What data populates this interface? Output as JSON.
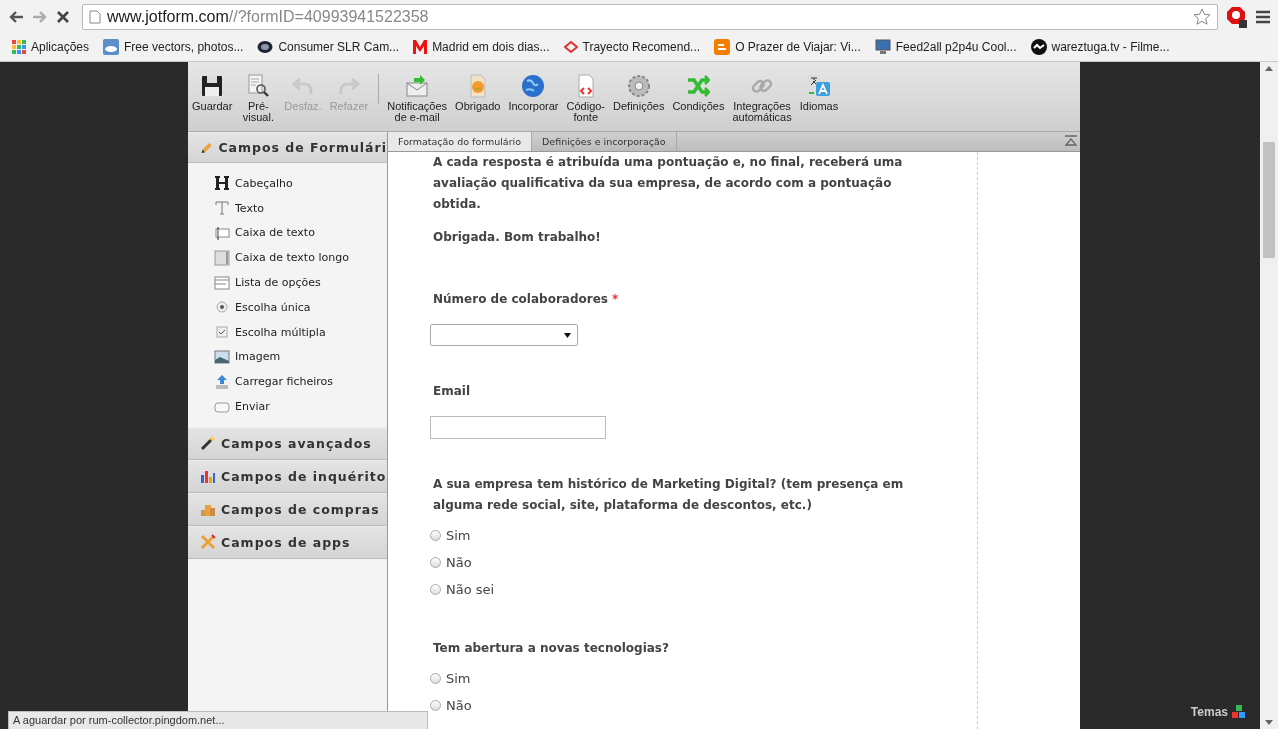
{
  "browser": {
    "url_host": "www.jotform.com",
    "url_path": "//?formID=40993941522358",
    "bookmarks": [
      {
        "label": "Aplicações"
      },
      {
        "label": "Free vectors, photos..."
      },
      {
        "label": "Consumer SLR Cam..."
      },
      {
        "label": "Madrid em dois dias..."
      },
      {
        "label": "Trayecto Recomend..."
      },
      {
        "label": "O Prazer de Viajar: Vi..."
      },
      {
        "label": "Feed2all p2p4u Cool..."
      },
      {
        "label": "wareztuga.tv - Filme..."
      }
    ]
  },
  "toolbar": {
    "groups": [
      [
        {
          "label": "Guardar",
          "disabled": false
        },
        {
          "label": "Pré-\nvisual.",
          "disabled": false
        },
        {
          "label": "Desfaz.",
          "disabled": true
        },
        {
          "label": "Refazer",
          "disabled": true
        }
      ],
      [
        {
          "label": "Notificações\nde e-mail",
          "disabled": false
        },
        {
          "label": "Obrigado",
          "disabled": false
        },
        {
          "label": "Incorporar",
          "disabled": false
        },
        {
          "label": "Código-\nfonte",
          "disabled": false
        },
        {
          "label": "Definições",
          "disabled": false
        },
        {
          "label": "Condições",
          "disabled": false
        },
        {
          "label": "Integrações\nautomáticas",
          "disabled": false
        },
        {
          "label": "Idiomas",
          "disabled": false
        }
      ]
    ]
  },
  "tabs": [
    {
      "label": "Formatação do formulário",
      "selected": true
    },
    {
      "label": "Definições e incorporação",
      "selected": false
    }
  ],
  "sidebar": {
    "sections": [
      {
        "title": "Campos de Formulári",
        "expanded": true,
        "items": [
          "Cabeçalho",
          "Texto",
          "Caixa de texto",
          "Caixa de texto longo",
          "Lista de opções",
          "Escolha única",
          "Escolha múltipla",
          "Imagem",
          "Carregar ficheiros",
          "Enviar"
        ]
      },
      {
        "title": "Campos avançados",
        "expanded": false
      },
      {
        "title": "Campos de inquérito",
        "expanded": false
      },
      {
        "title": "Campos de compras",
        "expanded": false
      },
      {
        "title": "Campos de apps",
        "expanded": false
      }
    ]
  },
  "form": {
    "intro": [
      "A cada resposta é atribuída uma pontuação e, no final, receberá uma avaliação qualificativa da sua empresa, de acordo com a pontuação obtida.",
      "Obrigada. Bom trabalho!"
    ],
    "questions": [
      {
        "kind": "dropdown",
        "label": "Número de colaboradores",
        "required_mark": "*"
      },
      {
        "kind": "textbox",
        "label": "Email"
      },
      {
        "kind": "radio",
        "label": "A sua empresa tem histórico de Marketing Digital? (tem presença em alguma rede social, site, plataforma de descontos, etc.)",
        "options": [
          {
            "label": "Sim",
            "selected": false
          },
          {
            "label": "Não",
            "selected": false
          },
          {
            "label": "Não sei",
            "selected": false
          }
        ]
      },
      {
        "kind": "radio",
        "label": "Tem abertura a novas tecnologias?",
        "options": [
          {
            "label": "Sim",
            "selected": false
          },
          {
            "label": "Não",
            "selected": false
          }
        ]
      }
    ]
  },
  "status_bar": "A aguardar por rum-collector.pingdom.net...",
  "themes_button": "Temas"
}
